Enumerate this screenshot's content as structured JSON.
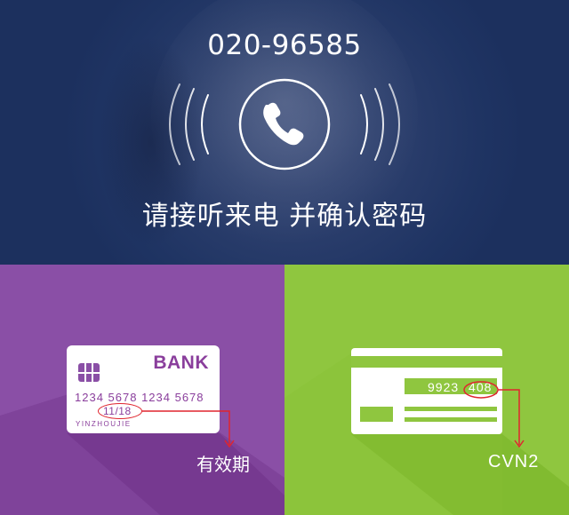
{
  "banner": {
    "phone_number": "020-96585",
    "headline": "请接听来电 并确认密码",
    "icon": "phone-ringing-icon"
  },
  "left_panel": {
    "card": {
      "bank_name": "BANK",
      "card_number": "1234 5678 1234 5678",
      "expiry": "11/18",
      "holder": "YINZHOUJIE",
      "icon": "chip-icon"
    },
    "callout_label": "有效期"
  },
  "right_panel": {
    "card_back": {
      "number": "9923",
      "cvn": "408"
    },
    "callout_label": "CVN2"
  },
  "colors": {
    "banner_bg": "#1f3463",
    "left_bg": "#8a4fa6",
    "left_shadow": "#7b3e96",
    "right_bg": "#8fc63f",
    "right_shadow": "#7fb82e",
    "highlight_red": "#e0252f"
  }
}
